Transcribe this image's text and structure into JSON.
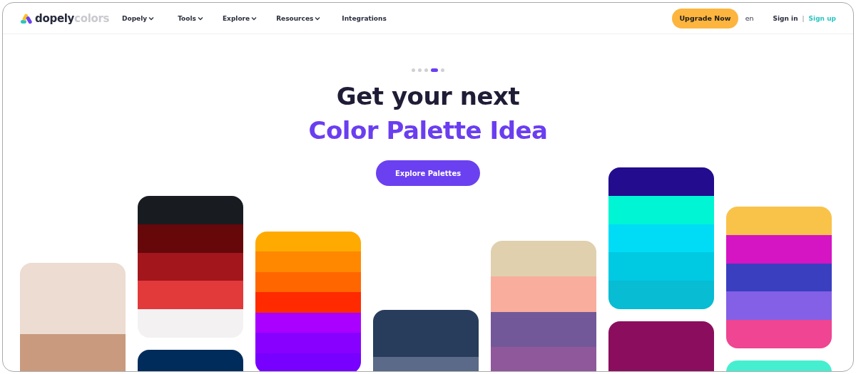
{
  "header": {
    "logo": {
      "bold": "dopely",
      "light": "colors"
    },
    "nav": [
      {
        "label": "Dopely",
        "dropdown": true
      },
      {
        "label": "Tools",
        "dropdown": true
      },
      {
        "label": "Explore",
        "dropdown": true
      },
      {
        "label": "Resources",
        "dropdown": true
      },
      {
        "label": "Integrations",
        "dropdown": false
      }
    ],
    "upgrade_button": "Upgrade Now",
    "language": "en",
    "sign_in": "Sign in",
    "separator": "|",
    "sign_up": "Sign up"
  },
  "hero": {
    "slides": [
      {
        "selected": false
      },
      {
        "selected": false
      },
      {
        "selected": false
      },
      {
        "selected": true
      },
      {
        "selected": false
      }
    ],
    "title_line_1": "Get your next",
    "title_line_2": "Color Palette Idea",
    "button": "Explore Palettes"
  },
  "palettes": [
    [
      {
        "swatches": [
          {
            "color": "#ecdcd2"
          },
          {
            "color": "#c99a7e"
          }
        ]
      }
    ],
    [
      {
        "swatches": [
          {
            "color": "#181c20"
          },
          {
            "color": "#66070a"
          },
          {
            "color": "#a3161c"
          },
          {
            "color": "#e2393b"
          },
          {
            "color": "#f3f1f2"
          }
        ]
      },
      {
        "swatches": [
          {
            "color": "#002c5c"
          }
        ]
      }
    ],
    [
      {
        "swatches": [
          {
            "color": "#ffaa00"
          },
          {
            "color": "#ff8800"
          },
          {
            "color": "#ff6600"
          },
          {
            "color": "#ff2a00"
          },
          {
            "color": "#aa00ff"
          },
          {
            "color": "#8800ff"
          },
          {
            "color": "#7700ff"
          }
        ]
      }
    ],
    [
      {
        "swatches": [
          {
            "color": "#283d5c"
          },
          {
            "color": "#5a6a88"
          }
        ]
      }
    ],
    [
      {
        "swatches": [
          {
            "color": "#e0d0ae"
          },
          {
            "color": "#f9ad9c"
          },
          {
            "color": "#735899"
          },
          {
            "color": "#8e589b"
          }
        ]
      }
    ],
    [
      {
        "swatches": [
          {
            "color": "#230c8e"
          },
          {
            "color": "#00f5d4"
          },
          {
            "color": "#00dcf5"
          },
          {
            "color": "#00c9e2"
          },
          {
            "color": "#07bcd3"
          }
        ]
      },
      {
        "swatches": [
          {
            "color": "#8b0e5e"
          }
        ]
      }
    ],
    [
      {
        "swatches": [
          {
            "color": "#f9c249"
          },
          {
            "color": "#d515c3"
          },
          {
            "color": "#3a3fc0"
          },
          {
            "color": "#8360e6"
          },
          {
            "color": "#ef4592"
          }
        ]
      },
      {
        "swatches": [
          {
            "color": "#46eed0"
          }
        ]
      }
    ]
  ]
}
